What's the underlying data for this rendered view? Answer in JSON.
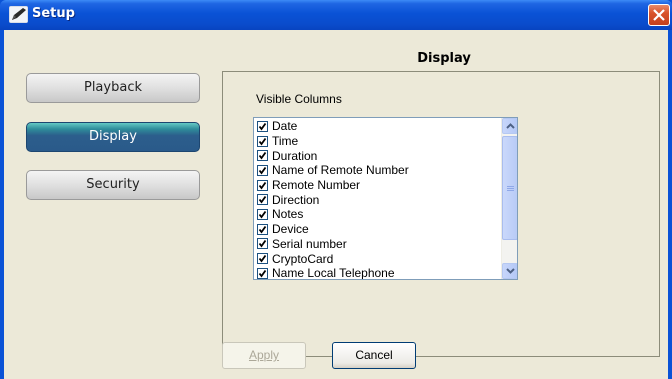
{
  "window": {
    "title": "Setup",
    "title_icon": "setup-pen-icon",
    "close_icon": "close-icon"
  },
  "nav": {
    "items": [
      {
        "label": "Playback",
        "active": false
      },
      {
        "label": "Display",
        "active": true
      },
      {
        "label": "Security",
        "active": false
      }
    ]
  },
  "panel": {
    "heading": "Display",
    "group_label": "Visible Columns",
    "columns": [
      {
        "label": "Date",
        "checked": true
      },
      {
        "label": "Time",
        "checked": true
      },
      {
        "label": "Duration",
        "checked": true
      },
      {
        "label": "Name of Remote Number",
        "checked": true
      },
      {
        "label": "Remote Number",
        "checked": true
      },
      {
        "label": "Direction",
        "checked": true
      },
      {
        "label": "Notes",
        "checked": true
      },
      {
        "label": "Device",
        "checked": true
      },
      {
        "label": "Serial number",
        "checked": true
      },
      {
        "label": "CryptoCard",
        "checked": true
      },
      {
        "label": "Name Local Telephone",
        "checked": true
      }
    ]
  },
  "buttons": {
    "apply_label": "Apply",
    "apply_enabled": false,
    "cancel_label": "Cancel"
  },
  "colors": {
    "titlebar": "#0a52d6",
    "active_nav": "#2c5e8c",
    "close_button": "#d9532a"
  }
}
